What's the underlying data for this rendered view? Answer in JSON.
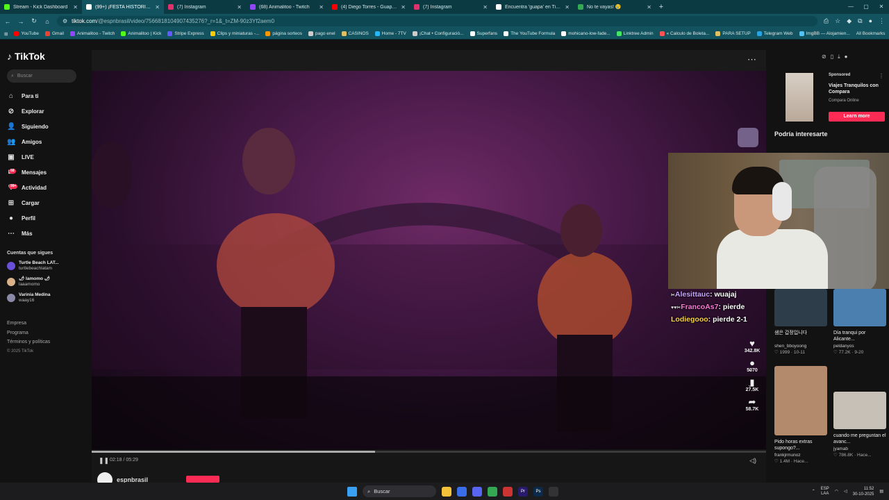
{
  "browser": {
    "tabs": [
      {
        "title": "Stream - Kick Dashboard",
        "color": "#53fc18",
        "active": false
      },
      {
        "title": "(99+) ¡FESTA HISTÓRICA du",
        "color": "#ffffff",
        "active": true
      },
      {
        "title": "(7) Instagram",
        "color": "#e1306c",
        "active": false
      },
      {
        "title": "(68) Animalitoo - Twitch",
        "color": "#9146ff",
        "active": false
      },
      {
        "title": "(4) Diego Torres - Guapa - YouT",
        "color": "#ff0000",
        "active": false
      },
      {
        "title": "(7) Instagram",
        "color": "#e1306c",
        "active": false
      },
      {
        "title": "Encuentra 'guapa' en TikTok | B",
        "color": "#ffffff",
        "active": false
      },
      {
        "title": "No te vayas! 😢",
        "color": "#34a853",
        "active": false
      }
    ],
    "url_host": "tiktok.com",
    "url_path": "/@espnbrasil/video/7566818104907435276?_r=1&_t=ZM-90z3Yf2aem0",
    "bookmarks": [
      {
        "label": "YouTube",
        "color": "#ff0000"
      },
      {
        "label": "Gmail",
        "color": "#ea4335"
      },
      {
        "label": "Animalitoo - Twitch",
        "color": "#9146ff"
      },
      {
        "label": "Animalitoo | Kick",
        "color": "#53fc18"
      },
      {
        "label": "Stripe Express",
        "color": "#635bff"
      },
      {
        "label": "Clips y miniaturas -...",
        "color": "#ffcc00"
      },
      {
        "label": "página sorteos",
        "color": "#ff9800"
      },
      {
        "label": "pago enel",
        "color": "#cccccc"
      },
      {
        "label": "CASINOS",
        "color": "#e0c060"
      },
      {
        "label": "Home - 7TV",
        "color": "#29b6f6"
      },
      {
        "label": "¡Chat • Configuració...",
        "color": "#cccccc"
      },
      {
        "label": "Superfans",
        "color": "#ffffff"
      },
      {
        "label": "The YouTube Formula",
        "color": "#ffffff"
      },
      {
        "label": "mohicano-low-fade...",
        "color": "#ffffff"
      },
      {
        "label": "Linktree Admin",
        "color": "#43e660"
      },
      {
        "label": "« Calculo de Boleta...",
        "color": "#ff5252"
      },
      {
        "label": "PARA SETUP",
        "color": "#e0c060"
      },
      {
        "label": "Telegram Web",
        "color": "#2aa3e0"
      },
      {
        "label": "ImgBB — Alojamien...",
        "color": "#4fc3f7"
      }
    ],
    "all_bookmarks": "All Bookmarks"
  },
  "sidebar": {
    "logo": "TikTok",
    "search_placeholder": "Buscar",
    "nav": [
      {
        "label": "Para ti",
        "icon": "home-icon",
        "glyph": "⌂",
        "badge": ""
      },
      {
        "label": "Explorar",
        "icon": "compass-icon",
        "glyph": "⊘",
        "badge": ""
      },
      {
        "label": "Siguiendo",
        "icon": "following-icon",
        "glyph": "👤",
        "badge": ""
      },
      {
        "label": "Amigos",
        "icon": "friends-icon",
        "glyph": "👥",
        "badge": ""
      },
      {
        "label": "LIVE",
        "icon": "live-icon",
        "glyph": "▣",
        "badge": ""
      },
      {
        "label": "Mensajes",
        "icon": "messages-icon",
        "glyph": "✉",
        "badge": "68"
      },
      {
        "label": "Actividad",
        "icon": "activity-icon",
        "glyph": "♡",
        "badge": "99+"
      },
      {
        "label": "Cargar",
        "icon": "upload-icon",
        "glyph": "⊞",
        "badge": ""
      },
      {
        "label": "Perfil",
        "icon": "profile-icon",
        "glyph": "●",
        "badge": ""
      },
      {
        "label": "Más",
        "icon": "more-icon",
        "glyph": "⋯",
        "badge": ""
      }
    ],
    "following_title": "Cuentas que sigues",
    "following": [
      {
        "name": "Turtle Beach LAT...",
        "user": "turtlebeachlatam",
        "color": "#6a4fd8"
      },
      {
        "name": "🌶 lamomo 🌶",
        "user": "laaamomo",
        "color": "#d9b28a"
      },
      {
        "name": "Varinia Medina",
        "user": "waay16",
        "color": "#8a8aa8"
      }
    ],
    "footer": [
      "Empresa",
      "Programa",
      "Términos y políticas"
    ],
    "copyright": "© 2025 TikTok"
  },
  "video": {
    "progress_fraction": 0.42,
    "time": "02:18 / 05:29",
    "author": "espnbrasil",
    "likes": "342.8K",
    "comments": "5070",
    "saves": "27.5K",
    "shares": "58.7K"
  },
  "right": {
    "sponsored_tag": "Sponsored",
    "sponsored_title": "Viajes Tranquilos con Compara",
    "sponsored_source": "Compara Online",
    "learn_more": "Learn more",
    "interest_title": "Podría interesarte",
    "cards": [
      {
        "title": "샘은 갑정입니다",
        "user": "shen_bboyoong",
        "stats": "♡ 1999 · 10-11",
        "color": "#2d3d4a"
      },
      {
        "title": "Día tranqui por Alicante...",
        "user": "peldanyos",
        "stats": "♡ 77.2K · 9-20",
        "color": "#4a7fb0"
      },
      {
        "title": "Pido horas extras supongo?...",
        "user": "frankjrmunoz",
        "stats": "♡ 1.4M · Hace...",
        "color": "#b48a6c"
      },
      {
        "title": "cuando me preguntan el avanc...",
        "user": "jyamab",
        "stats": "♡ 786.8K · Hace...",
        "color": "#c7c0b6"
      }
    ]
  },
  "chat": [
    {
      "name": "Alesittauc",
      "msg": "wuajaj",
      "color": "#c9a4ff"
    },
    {
      "name": "FrancoAs7",
      "msg": "pierde",
      "color": "#ff7ad9"
    },
    {
      "name": "Lodiegooo",
      "msg": "pierde 2-1",
      "color": "#ffd23f"
    }
  ],
  "taskbar": {
    "search": "Buscar",
    "lang_top": "ESP",
    "lang_bottom": "LAA",
    "time": "11:52",
    "date": "30-10-2025"
  }
}
